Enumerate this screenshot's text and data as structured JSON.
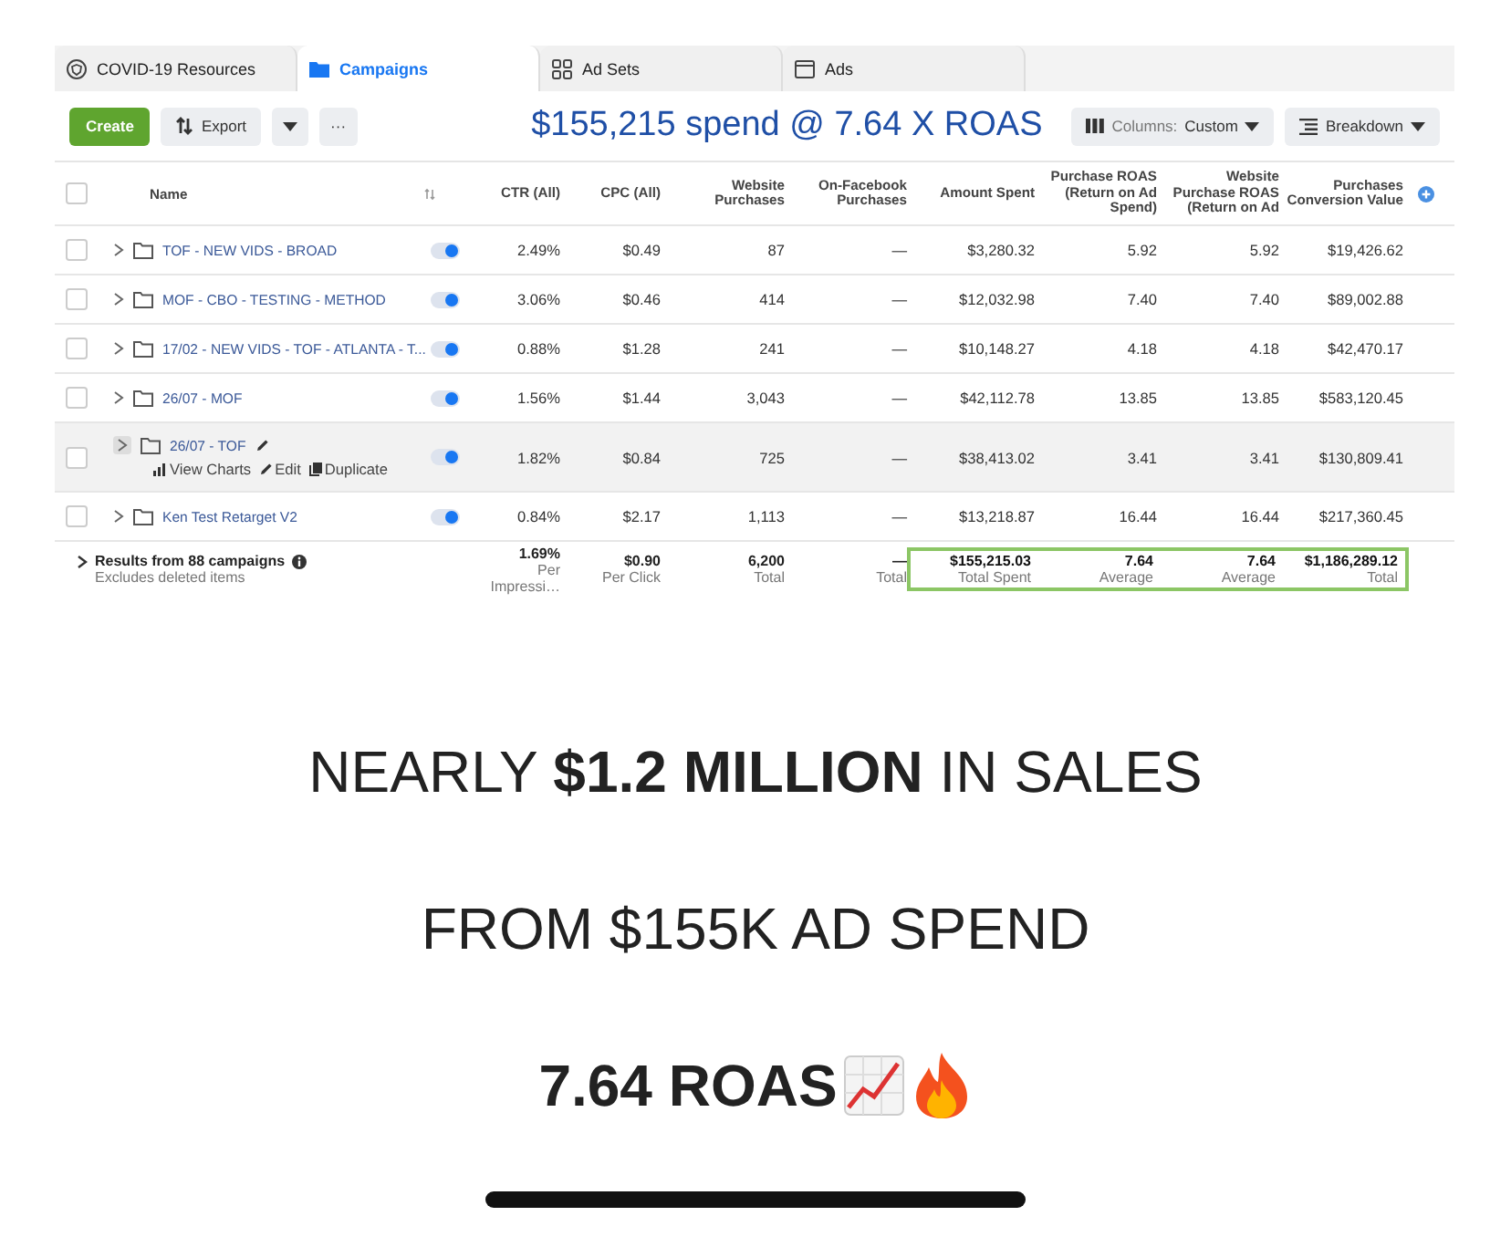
{
  "tabs": [
    {
      "label": "COVID-19 Resources",
      "kind": "resources",
      "selected": false
    },
    {
      "label": "Campaigns",
      "kind": "campaigns",
      "selected": true
    },
    {
      "label": "Ad Sets",
      "kind": "adsets",
      "selected": false
    },
    {
      "label": "Ads",
      "kind": "ads",
      "selected": false
    }
  ],
  "toolbar": {
    "create": "Create",
    "export": "Export",
    "more": "···",
    "headline": "$155,215 spend @ 7.64 X ROAS",
    "columns_label": "Columns:",
    "columns_value": "Custom",
    "breakdown": "Breakdown"
  },
  "table": {
    "header_checked": false,
    "name_column": "Name",
    "columns": [
      "CTR (All)",
      "CPC (All)",
      "Website Purchases",
      "On-Facebook Purchases",
      "Amount Spent",
      "Purchase ROAS (Return on Ad Spend)",
      "Website Purchase ROAS (Return on Ad",
      "Purchases Conversion Value"
    ],
    "rows": [
      {
        "name": "TOF - NEW VIDS - BROAD",
        "checked": false,
        "on": true,
        "hovered": false,
        "cells": [
          "2.49%",
          "$0.49",
          "87",
          "—",
          "$3,280.32",
          "5.92",
          "5.92",
          "$19,426.62"
        ]
      },
      {
        "name": "MOF - CBO - TESTING - METHOD",
        "checked": false,
        "on": true,
        "hovered": false,
        "cells": [
          "3.06%",
          "$0.46",
          "414",
          "—",
          "$12,032.98",
          "7.40",
          "7.40",
          "$89,002.88"
        ]
      },
      {
        "name": "17/02 - NEW VIDS - TOF - ATLANTA - T...",
        "checked": false,
        "on": true,
        "hovered": false,
        "cells": [
          "0.88%",
          "$1.28",
          "241",
          "—",
          "$10,148.27",
          "4.18",
          "4.18",
          "$42,470.17"
        ]
      },
      {
        "name": "26/07 - MOF",
        "checked": false,
        "on": true,
        "hovered": false,
        "cells": [
          "1.56%",
          "$1.44",
          "3,043",
          "—",
          "$42,112.78",
          "13.85",
          "13.85",
          "$583,120.45"
        ]
      },
      {
        "name": "26/07 - TOF",
        "checked": false,
        "on": true,
        "hovered": true,
        "actions": [
          "View Charts",
          "Edit",
          "Duplicate"
        ],
        "cells": [
          "1.82%",
          "$0.84",
          "725",
          "—",
          "$38,413.02",
          "3.41",
          "3.41",
          "$130,809.41"
        ]
      },
      {
        "name": "Ken Test Retarget V2",
        "checked": false,
        "on": true,
        "hovered": false,
        "cells": [
          "0.84%",
          "$2.17",
          "1,113",
          "—",
          "$13,218.87",
          "16.44",
          "16.44",
          "$217,360.45"
        ]
      }
    ],
    "footer": {
      "title": "Results from 88 campaigns",
      "note": "Excludes deleted items",
      "cells": [
        {
          "value": "1.69%",
          "label": "Per Impressi…",
          "highlighted": false
        },
        {
          "value": "$0.90",
          "label": "Per Click",
          "highlighted": false
        },
        {
          "value": "6,200",
          "label": "Total",
          "highlighted": false
        },
        {
          "value": "—",
          "label": "Total",
          "highlighted": false
        },
        {
          "value": "$155,215.03",
          "label": "Total Spent",
          "highlighted": true
        },
        {
          "value": "7.64",
          "label": "Average",
          "highlighted": true
        },
        {
          "value": "7.64",
          "label": "Average",
          "highlighted": true
        },
        {
          "value": "$1,186,289.12",
          "label": "Total",
          "highlighted": true
        }
      ]
    }
  },
  "promo": [
    {
      "text": "NEARLY **$1.2 MILLION** IN SALES",
      "bold": false,
      "kind": "plain"
    },
    {
      "text": "FROM $155K AD SPEND",
      "bold": false,
      "kind": "plain"
    },
    {
      "text": "7.64 ROAS",
      "bold": true,
      "kind": "emoji"
    }
  ]
}
